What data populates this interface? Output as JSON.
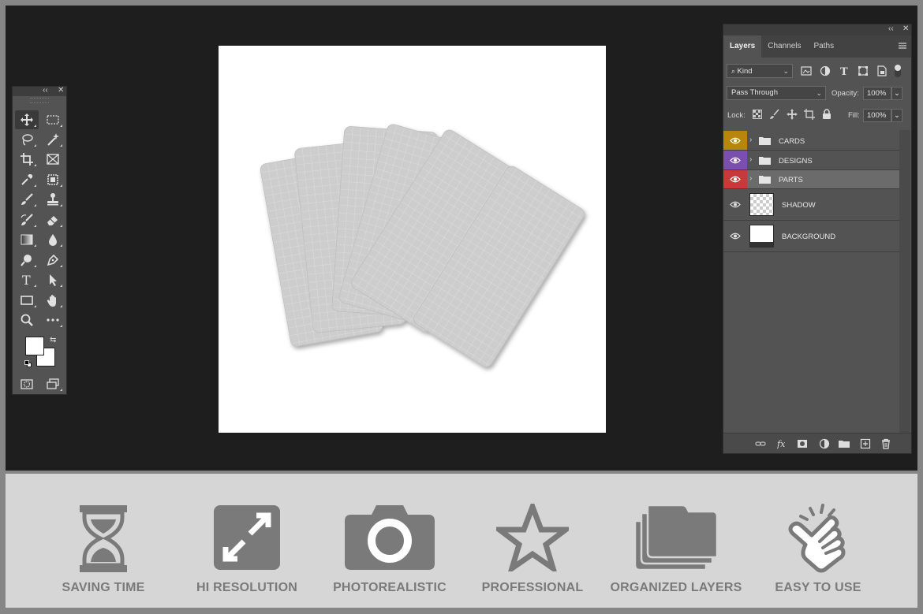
{
  "tools_panel": {
    "collapse_glyph": "‹‹",
    "close_glyph": "✕",
    "tools": [
      {
        "name": "move-tool-icon",
        "glyph": "move"
      },
      {
        "name": "marquee-tool-icon",
        "glyph": "marquee"
      },
      {
        "name": "lasso-tool-icon",
        "glyph": "lasso"
      },
      {
        "name": "magic-wand-tool-icon",
        "glyph": "wand"
      },
      {
        "name": "crop-tool-icon",
        "glyph": "crop"
      },
      {
        "name": "frame-tool-icon",
        "glyph": "frame"
      },
      {
        "name": "eyedropper-tool-icon",
        "glyph": "eyedropper"
      },
      {
        "name": "healing-tool-icon",
        "glyph": "healing"
      },
      {
        "name": "brush-tool-icon",
        "glyph": "brush"
      },
      {
        "name": "stamp-tool-icon",
        "glyph": "stamp"
      },
      {
        "name": "history-brush-tool-icon",
        "glyph": "history"
      },
      {
        "name": "eraser-tool-icon",
        "glyph": "eraser"
      },
      {
        "name": "gradient-tool-icon",
        "glyph": "gradient"
      },
      {
        "name": "blur-tool-icon",
        "glyph": "blur"
      },
      {
        "name": "dodge-tool-icon",
        "glyph": "dodge"
      },
      {
        "name": "pen-tool-icon",
        "glyph": "pen"
      },
      {
        "name": "type-tool-icon",
        "glyph": "T"
      },
      {
        "name": "path-selection-tool-icon",
        "glyph": "arrow"
      },
      {
        "name": "rectangle-tool-icon",
        "glyph": "rect"
      },
      {
        "name": "hand-tool-icon",
        "glyph": "hand"
      },
      {
        "name": "zoom-tool-icon",
        "glyph": "zoom"
      },
      {
        "name": "more-tools-icon",
        "glyph": "•••"
      }
    ],
    "foreground_color": "#ffffff",
    "background_color": "#ffffff"
  },
  "layers_panel": {
    "collapse_glyph": "‹‹",
    "close_glyph": "✕",
    "tabs": [
      "Layers",
      "Channels",
      "Paths"
    ],
    "active_tab": "Layers",
    "filter_kind": "Kind",
    "blend_mode": "Pass Through",
    "opacity_label": "Opacity:",
    "opacity_value": "100%",
    "lock_label": "Lock:",
    "fill_label": "Fill:",
    "fill_value": "100%",
    "layers": [
      {
        "name": "CARDS",
        "type": "group",
        "tag_color": "#b8860b"
      },
      {
        "name": "DESIGNS",
        "type": "group",
        "tag_color": "#7a4fb0"
      },
      {
        "name": "PARTS",
        "type": "group",
        "tag_color": "#c83a3a",
        "selected": true
      },
      {
        "name": "SHADOW",
        "type": "layer",
        "thumb": "transparent"
      },
      {
        "name": "BACKGROUND",
        "type": "layer",
        "thumb": "white"
      }
    ]
  },
  "features": [
    {
      "label": "SAVING TIME",
      "icon": "hourglass-icon"
    },
    {
      "label": "HI RESOLUTION",
      "icon": "expand-icon"
    },
    {
      "label": "PHOTOREALISTIC",
      "icon": "camera-icon"
    },
    {
      "label": "PROFESSIONAL",
      "icon": "star-icon"
    },
    {
      "label": "ORGANIZED LAYERS",
      "icon": "folders-icon"
    },
    {
      "label": "EASY TO USE",
      "icon": "tap-hand-icon"
    }
  ],
  "colors": {
    "workspace": "#1e1e1e",
    "panel": "#535353",
    "feature_icon": "#7a7a7a",
    "card": "#cfcfcf"
  }
}
